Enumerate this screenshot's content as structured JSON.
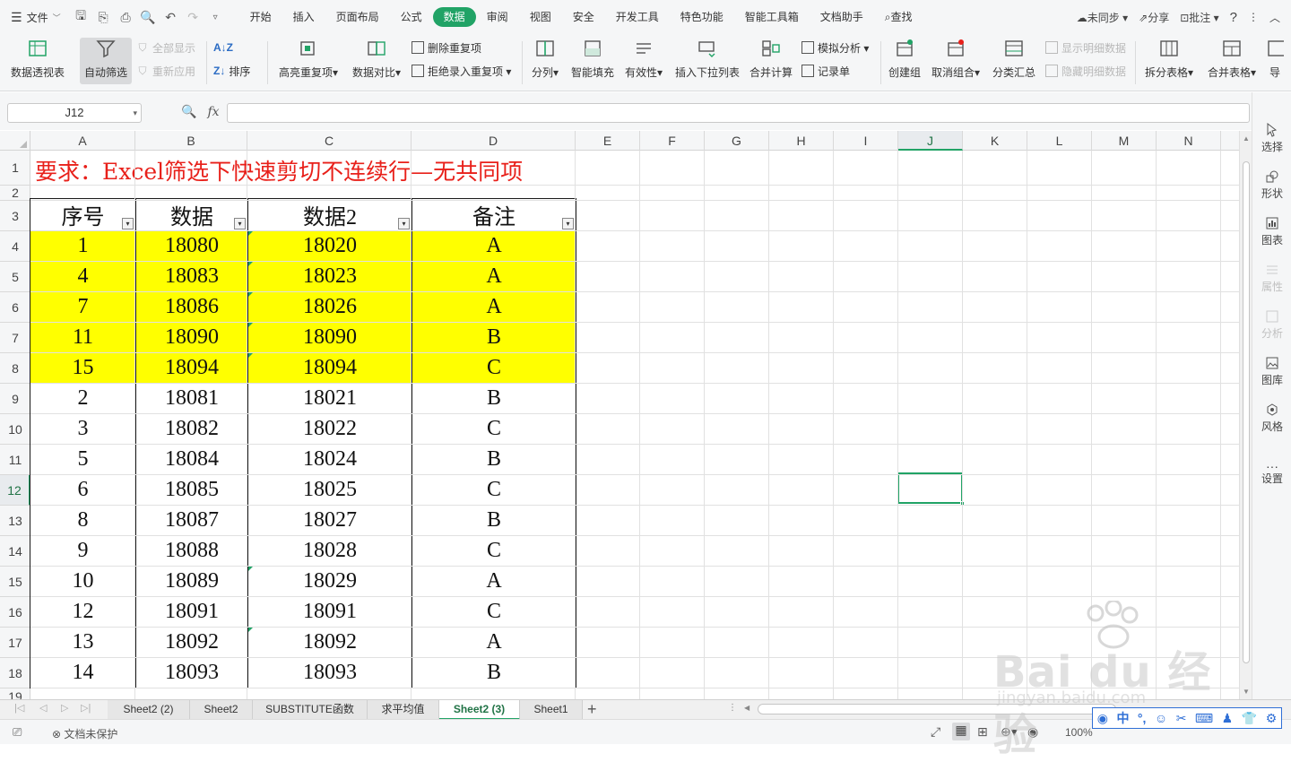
{
  "menubar": {
    "file_label": "文件",
    "tabs": [
      "开始",
      "插入",
      "页面布局",
      "公式",
      "数据",
      "审阅",
      "视图",
      "安全",
      "开发工具",
      "特色功能",
      "智能工具箱",
      "文档助手"
    ],
    "active_tab": "数据",
    "search_label": "查找",
    "sync_label": "未同步",
    "share_label": "分享",
    "annotate_label": "批注"
  },
  "ribbon": {
    "pivot": "数据透视表",
    "autofilter": "自动筛选",
    "show_all": "全部显示",
    "reapply": "重新应用",
    "sort": "排序",
    "highlight_dup": "高亮重复项",
    "compare": "数据对比",
    "delete_dup": "删除重复项",
    "reject_dup": "拒绝录入重复项",
    "split": "分列",
    "smart_fill": "智能填充",
    "validity": "有效性",
    "insert_dropdown": "插入下拉列表",
    "merge_calc": "合并计算",
    "simulate": "模拟分析",
    "record": "记录单",
    "create_group": "创建组",
    "ungroup": "取消组合",
    "subtotal": "分类汇总",
    "show_detail": "显示明细数据",
    "hide_detail": "隐藏明细数据",
    "split_table": "拆分表格",
    "merge_table": "合并表格",
    "import": "导"
  },
  "formula": {
    "name_box": "J12",
    "fx": "fx",
    "content": ""
  },
  "columns": [
    "A",
    "B",
    "C",
    "D",
    "E",
    "F",
    "G",
    "H",
    "I",
    "J",
    "K",
    "L",
    "M",
    "N"
  ],
  "rows": [
    "1",
    "2",
    "3",
    "4",
    "5",
    "6",
    "7",
    "8",
    "9",
    "10",
    "11",
    "12",
    "13",
    "14",
    "15",
    "16",
    "17",
    "18",
    "19"
  ],
  "selected_cell": "J12",
  "title": "要求：Excel筛选下快速剪切不连续行—无共同项",
  "table": {
    "headers": [
      "序号",
      "数据",
      "数据2",
      "备注"
    ],
    "rows": [
      {
        "c": [
          "1",
          "18080",
          "18020",
          "A"
        ],
        "hl": true
      },
      {
        "c": [
          "4",
          "18083",
          "18023",
          "A"
        ],
        "hl": true
      },
      {
        "c": [
          "7",
          "18086",
          "18026",
          "A"
        ],
        "hl": true
      },
      {
        "c": [
          "11",
          "18090",
          "18090",
          "B"
        ],
        "hl": true
      },
      {
        "c": [
          "15",
          "18094",
          "18094",
          "C"
        ],
        "hl": true
      },
      {
        "c": [
          "2",
          "18081",
          "18021",
          "B"
        ],
        "hl": false
      },
      {
        "c": [
          "3",
          "18082",
          "18022",
          "C"
        ],
        "hl": false
      },
      {
        "c": [
          "5",
          "18084",
          "18024",
          "B"
        ],
        "hl": false
      },
      {
        "c": [
          "6",
          "18085",
          "18025",
          "C"
        ],
        "hl": false
      },
      {
        "c": [
          "8",
          "18087",
          "18027",
          "B"
        ],
        "hl": false
      },
      {
        "c": [
          "9",
          "18088",
          "18028",
          "C"
        ],
        "hl": false
      },
      {
        "c": [
          "10",
          "18089",
          "18029",
          "A"
        ],
        "hl": false
      },
      {
        "c": [
          "12",
          "18091",
          "18091",
          "C"
        ],
        "hl": false
      },
      {
        "c": [
          "13",
          "18092",
          "18092",
          "A"
        ],
        "hl": false
      },
      {
        "c": [
          "14",
          "18093",
          "18093",
          "B"
        ],
        "hl": false
      }
    ],
    "highlight_color": "#ffff00"
  },
  "side_panel": [
    "选择",
    "形状",
    "图表",
    "属性",
    "分析",
    "图库",
    "风格",
    "设置"
  ],
  "sheets": [
    "Sheet2 (2)",
    "Sheet2",
    "SUBSTITUTE函数",
    "求平均值",
    "Sheet2 (3)",
    "Sheet1"
  ],
  "active_sheet": "Sheet2 (3)",
  "status": {
    "protect": "文档未保护",
    "zoom": "100%"
  },
  "watermark": {
    "brand": "Bai du 经验",
    "url": "jingyan.baidu.com"
  },
  "ime": {
    "lang": "中"
  },
  "colors": {
    "accent": "#21a366",
    "title_red": "#e8201a",
    "highlight": "#ffff00"
  }
}
